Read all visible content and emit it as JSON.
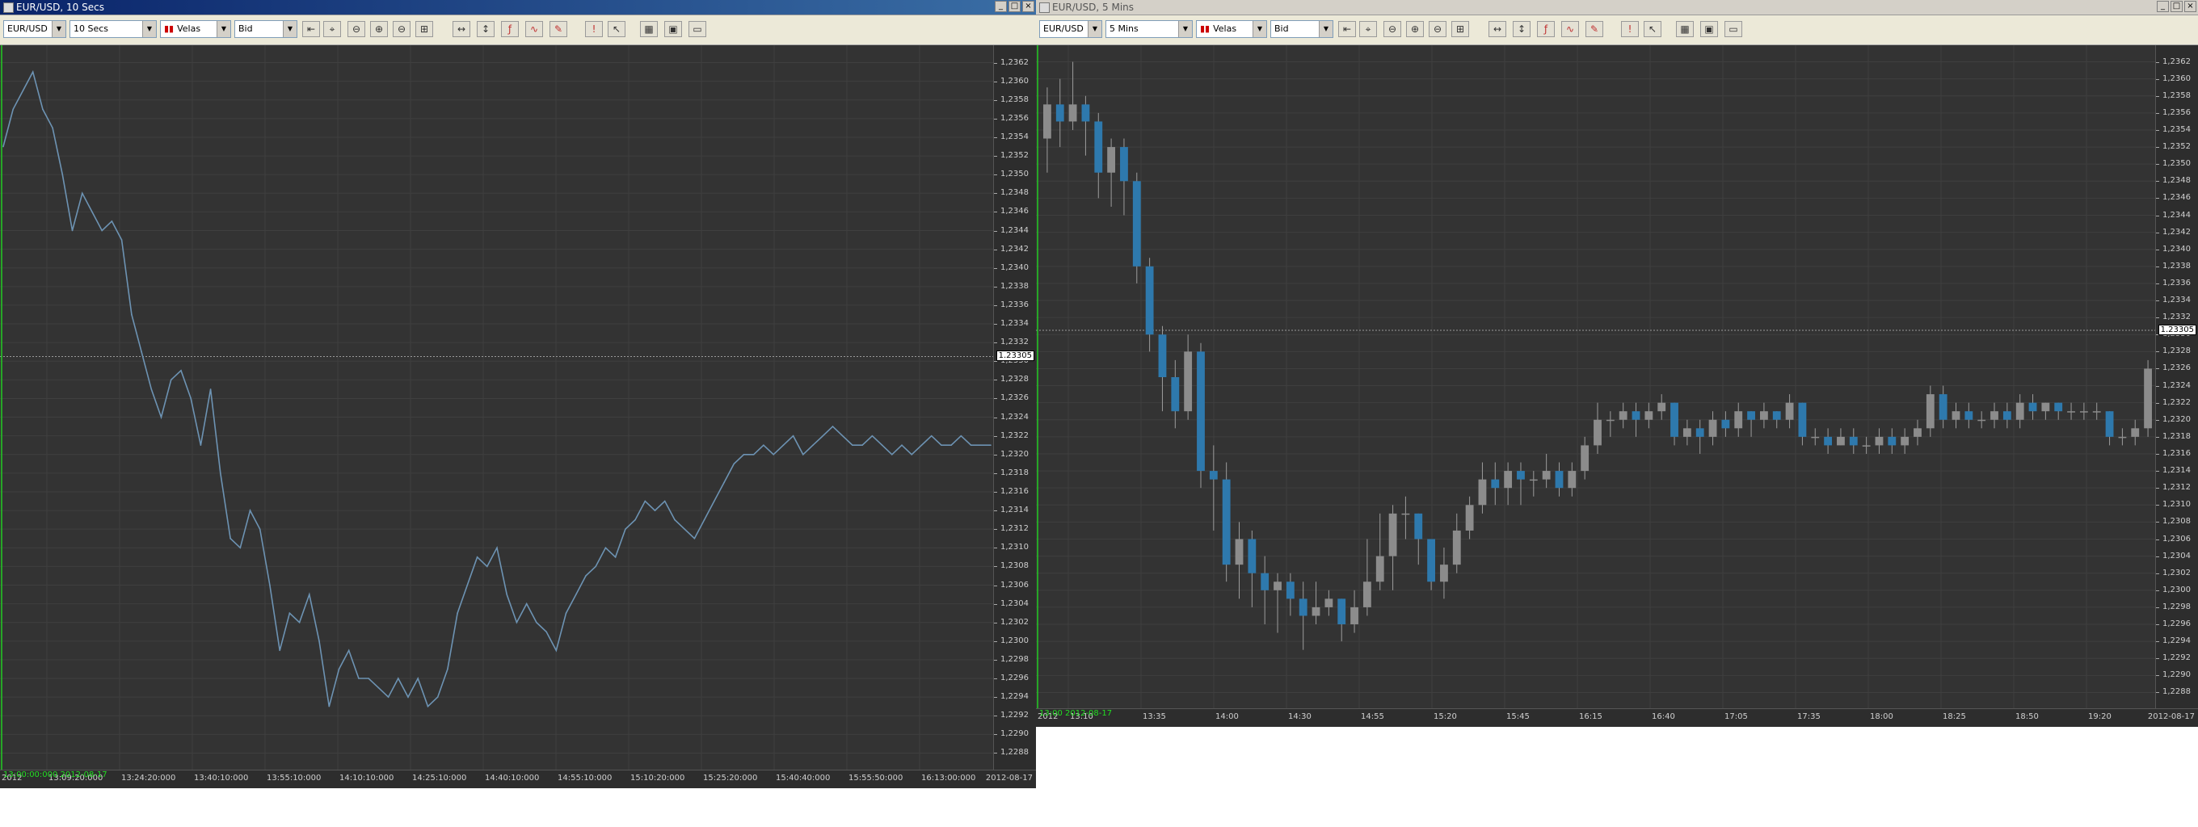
{
  "left_window": {
    "title": "EUR/USD, 10 Secs",
    "buttons": [
      "_",
      "□",
      "×"
    ],
    "toolbar": {
      "instrument": "EUR/USD",
      "period": "10 Secs",
      "chart_style": "Velas",
      "price_side": "Bid"
    },
    "current_price": "1.23305",
    "start_label": "13:00:00:000 2012-08-17",
    "left_year": "2012",
    "right_date": "2012-08-17",
    "colors": {
      "background": "#333333",
      "line": "#6d93b3",
      "grid": "#3f3f3f"
    }
  },
  "right_window": {
    "title": "EUR/USD, 5 Mins",
    "buttons": [
      "_",
      "□",
      "×"
    ],
    "toolbar": {
      "instrument": "EUR/USD",
      "period": "5 Mins",
      "chart_style": "Velas",
      "price_side": "Bid"
    },
    "current_price": "1.23305",
    "start_label": "13:00 2012-08-17",
    "left_year": "2012",
    "right_date": "2012-08-17",
    "colors": {
      "background": "#333333",
      "bullish": "#8c8c8c",
      "bearish": "#2e79ad",
      "grid": "#3f3f3f"
    }
  },
  "toolbar_icons": [
    "zoom-in-icon",
    "zoom-out-icon",
    "zoom-fit-icon",
    "crosshair-icon",
    "cursor-icon",
    "indicator-icon",
    "drawing-icon",
    "alert-icon",
    "save-icon",
    "layout-icon"
  ],
  "chart_data": [
    {
      "type": "line",
      "series_name": "EUR/USD",
      "x_ticks": [
        "13:09:20:000",
        "13:24:20:000",
        "13:40:10:000",
        "13:55:10:000",
        "14:10:10:000",
        "14:25:10:000",
        "14:40:10:000",
        "14:55:10:000",
        "15:10:20:000",
        "15:25:20:000",
        "15:40:40:000",
        "15:55:50:000",
        "16:13:00:000"
      ],
      "y_ticks": [
        "1,2362",
        "1,2360",
        "1,2358",
        "1,2356",
        "1,2354",
        "1,2352",
        "1,2350",
        "1,2348",
        "1,2346",
        "1,2344",
        "1,2342",
        "1,2340",
        "1,2338",
        "1,2336",
        "1,2334",
        "1,2332",
        "1,2330",
        "1,2328",
        "1,2326",
        "1,2324",
        "1,2322",
        "1,2320",
        "1,2318",
        "1,2316",
        "1,2314",
        "1,2312",
        "1,2310",
        "1,2308",
        "1,2306",
        "1,2304",
        "1,2302",
        "1,2300",
        "1,2298",
        "1,2296",
        "1,2294",
        "1,2292",
        "1,2290",
        "1,2288"
      ],
      "ylim": [
        1.2287,
        1.2363
      ],
      "x": [
        0,
        1,
        2,
        3,
        4,
        5,
        6,
        7,
        8,
        9,
        10,
        11,
        12,
        13,
        14,
        15,
        16,
        17,
        18,
        19,
        20,
        21,
        22,
        23,
        24,
        25,
        26,
        27,
        28,
        29,
        30,
        31,
        32,
        33,
        34,
        35,
        36,
        37,
        38,
        39,
        40,
        41,
        42,
        43,
        44,
        45,
        46,
        47,
        48,
        49,
        50,
        51,
        52,
        53,
        54,
        55,
        56,
        57,
        58,
        59,
        60,
        61,
        62,
        63,
        64,
        65,
        66,
        67,
        68,
        69,
        70,
        71,
        72,
        73,
        74,
        75,
        76,
        77,
        78,
        79,
        80,
        81,
        82,
        83,
        84,
        85,
        86,
        87,
        88,
        89,
        90,
        91,
        92,
        93,
        94,
        95,
        96,
        97,
        98,
        99,
        100
      ],
      "values": [
        1.2353,
        1.2357,
        1.2359,
        1.2361,
        1.2357,
        1.2355,
        1.235,
        1.2344,
        1.2348,
        1.2346,
        1.2344,
        1.2345,
        1.2343,
        1.2335,
        1.2331,
        1.2327,
        1.2324,
        1.2328,
        1.2329,
        1.2326,
        1.2321,
        1.2327,
        1.2318,
        1.2311,
        1.231,
        1.2314,
        1.2312,
        1.2306,
        1.2299,
        1.2303,
        1.2302,
        1.2305,
        1.23,
        1.2293,
        1.2297,
        1.2299,
        1.2296,
        1.2296,
        1.2295,
        1.2294,
        1.2296,
        1.2294,
        1.2296,
        1.2293,
        1.2294,
        1.2297,
        1.2303,
        1.2306,
        1.2309,
        1.2308,
        1.231,
        1.2305,
        1.2302,
        1.2304,
        1.2302,
        1.2301,
        1.2299,
        1.2303,
        1.2305,
        1.2307,
        1.2308,
        1.231,
        1.2309,
        1.2312,
        1.2313,
        1.2315,
        1.2314,
        1.2315,
        1.2313,
        1.2312,
        1.2311,
        1.2313,
        1.2315,
        1.2317,
        1.2319,
        1.232,
        1.232,
        1.2321,
        1.232,
        1.2321,
        1.2322,
        1.232,
        1.2321,
        1.2322,
        1.2323,
        1.2322,
        1.2321,
        1.2321,
        1.2322,
        1.2321,
        1.232,
        1.2321,
        1.232,
        1.2321,
        1.2322,
        1.2321,
        1.2321,
        1.2322,
        1.2321,
        1.2321,
        1.2321
      ]
    },
    {
      "type": "candlestick",
      "series_name": "EUR/USD",
      "x_ticks": [
        "13:10",
        "13:35",
        "14:00",
        "14:30",
        "14:55",
        "15:20",
        "15:45",
        "16:15",
        "16:40",
        "17:05",
        "17:35",
        "18:00",
        "18:25",
        "18:50",
        "19:20"
      ],
      "y_ticks": [
        "1,2362",
        "1,2360",
        "1,2358",
        "1,2356",
        "1,2354",
        "1,2352",
        "1,2350",
        "1,2348",
        "1,2346",
        "1,2344",
        "1,2342",
        "1,2340",
        "1,2338",
        "1,2336",
        "1,2334",
        "1,2332",
        "1,2330",
        "1,2328",
        "1,2326",
        "1,2324",
        "1,2322",
        "1,2320",
        "1,2318",
        "1,2316",
        "1,2314",
        "1,2312",
        "1,2310",
        "1,2308",
        "1,2306",
        "1,2304",
        "1,2302",
        "1,2300",
        "1,2298",
        "1,2296",
        "1,2294",
        "1,2292",
        "1,2290",
        "1,2288"
      ],
      "ylim": [
        1.2287,
        1.2363
      ],
      "candles": [
        [
          1.2353,
          1.2357,
          1.2359,
          1.2349
        ],
        [
          1.2357,
          1.2355,
          1.236,
          1.2352
        ],
        [
          1.2355,
          1.2357,
          1.2362,
          1.2354
        ],
        [
          1.2357,
          1.2355,
          1.2358,
          1.2351
        ],
        [
          1.2355,
          1.2349,
          1.2356,
          1.2346
        ],
        [
          1.2349,
          1.2352,
          1.2353,
          1.2345
        ],
        [
          1.2352,
          1.2348,
          1.2353,
          1.2344
        ],
        [
          1.2348,
          1.2338,
          1.2349,
          1.2336
        ],
        [
          1.2338,
          1.233,
          1.2339,
          1.2328
        ],
        [
          1.233,
          1.2325,
          1.2331,
          1.2321
        ],
        [
          1.2325,
          1.2321,
          1.2327,
          1.2319
        ],
        [
          1.2321,
          1.2328,
          1.233,
          1.232
        ],
        [
          1.2328,
          1.2314,
          1.2329,
          1.2312
        ],
        [
          1.2314,
          1.2313,
          1.2317,
          1.2307
        ],
        [
          1.2313,
          1.2303,
          1.2315,
          1.2301
        ],
        [
          1.2303,
          1.2306,
          1.2308,
          1.2299
        ],
        [
          1.2306,
          1.2302,
          1.2307,
          1.2298
        ],
        [
          1.2302,
          1.23,
          1.2304,
          1.2296
        ],
        [
          1.23,
          1.2301,
          1.2302,
          1.2295
        ],
        [
          1.2301,
          1.2299,
          1.2302,
          1.2297
        ],
        [
          1.2299,
          1.2297,
          1.2301,
          1.2293
        ],
        [
          1.2297,
          1.2298,
          1.2301,
          1.2296
        ],
        [
          1.2298,
          1.2299,
          1.23,
          1.2297
        ],
        [
          1.2299,
          1.2296,
          1.2299,
          1.2294
        ],
        [
          1.2296,
          1.2298,
          1.23,
          1.2295
        ],
        [
          1.2298,
          1.2301,
          1.2306,
          1.2297
        ],
        [
          1.2301,
          1.2304,
          1.2309,
          1.23
        ],
        [
          1.2304,
          1.2309,
          1.231,
          1.23
        ],
        [
          1.2309,
          1.2309,
          1.2311,
          1.2306
        ],
        [
          1.2309,
          1.2306,
          1.2309,
          1.2303
        ],
        [
          1.2306,
          1.2301,
          1.2306,
          1.23
        ],
        [
          1.2301,
          1.2303,
          1.2305,
          1.2299
        ],
        [
          1.2303,
          1.2307,
          1.2309,
          1.2302
        ],
        [
          1.2307,
          1.231,
          1.2311,
          1.2306
        ],
        [
          1.231,
          1.2313,
          1.2315,
          1.2309
        ],
        [
          1.2313,
          1.2312,
          1.2315,
          1.231
        ],
        [
          1.2312,
          1.2314,
          1.2315,
          1.231
        ],
        [
          1.2314,
          1.2313,
          1.2315,
          1.231
        ],
        [
          1.2313,
          1.2313,
          1.2314,
          1.2311
        ],
        [
          1.2313,
          1.2314,
          1.2316,
          1.2312
        ],
        [
          1.2314,
          1.2312,
          1.2315,
          1.2311
        ],
        [
          1.2312,
          1.2314,
          1.2315,
          1.2311
        ],
        [
          1.2314,
          1.2317,
          1.2318,
          1.2313
        ],
        [
          1.2317,
          1.232,
          1.2322,
          1.2316
        ],
        [
          1.232,
          1.232,
          1.2321,
          1.2318
        ],
        [
          1.232,
          1.2321,
          1.2322,
          1.2319
        ],
        [
          1.2321,
          1.232,
          1.2322,
          1.2318
        ],
        [
          1.232,
          1.2321,
          1.2322,
          1.2319
        ],
        [
          1.2321,
          1.2322,
          1.2323,
          1.232
        ],
        [
          1.2322,
          1.2318,
          1.2322,
          1.2317
        ],
        [
          1.2318,
          1.2319,
          1.232,
          1.2317
        ],
        [
          1.2319,
          1.2318,
          1.232,
          1.2316
        ],
        [
          1.2318,
          1.232,
          1.2321,
          1.2317
        ],
        [
          1.232,
          1.2319,
          1.2321,
          1.2318
        ],
        [
          1.2319,
          1.2321,
          1.2322,
          1.2318
        ],
        [
          1.2321,
          1.232,
          1.2321,
          1.2318
        ],
        [
          1.232,
          1.2321,
          1.2322,
          1.2319
        ],
        [
          1.2321,
          1.232,
          1.2321,
          1.2319
        ],
        [
          1.232,
          1.2322,
          1.2323,
          1.2319
        ],
        [
          1.2322,
          1.2318,
          1.2322,
          1.2317
        ],
        [
          1.2318,
          1.2318,
          1.2319,
          1.2317
        ],
        [
          1.2318,
          1.2317,
          1.2319,
          1.2316
        ],
        [
          1.2317,
          1.2318,
          1.2319,
          1.2317
        ],
        [
          1.2318,
          1.2317,
          1.2319,
          1.2316
        ],
        [
          1.2317,
          1.2317,
          1.2318,
          1.2316
        ],
        [
          1.2317,
          1.2318,
          1.2319,
          1.2316
        ],
        [
          1.2318,
          1.2317,
          1.2319,
          1.2316
        ],
        [
          1.2317,
          1.2318,
          1.2319,
          1.2316
        ],
        [
          1.2318,
          1.2319,
          1.232,
          1.2317
        ],
        [
          1.2319,
          1.2323,
          1.2324,
          1.2318
        ],
        [
          1.2323,
          1.232,
          1.2324,
          1.2319
        ],
        [
          1.232,
          1.2321,
          1.2322,
          1.2319
        ],
        [
          1.2321,
          1.232,
          1.2322,
          1.2319
        ],
        [
          1.232,
          1.232,
          1.2321,
          1.2319
        ],
        [
          1.232,
          1.2321,
          1.2322,
          1.2319
        ],
        [
          1.2321,
          1.232,
          1.2322,
          1.2319
        ],
        [
          1.232,
          1.2322,
          1.2323,
          1.2319
        ],
        [
          1.2322,
          1.2321,
          1.2323,
          1.232
        ],
        [
          1.2321,
          1.2322,
          1.2322,
          1.232
        ],
        [
          1.2322,
          1.2321,
          1.2322,
          1.232
        ],
        [
          1.2321,
          1.2321,
          1.2322,
          1.232
        ],
        [
          1.2321,
          1.2321,
          1.2322,
          1.232
        ],
        [
          1.2321,
          1.2321,
          1.2322,
          1.232
        ],
        [
          1.2321,
          1.2318,
          1.2321,
          1.2317
        ],
        [
          1.2318,
          1.2318,
          1.2319,
          1.2317
        ],
        [
          1.2318,
          1.2319,
          1.232,
          1.2317
        ],
        [
          1.2319,
          1.2326,
          1.2327,
          1.2318
        ]
      ]
    }
  ]
}
